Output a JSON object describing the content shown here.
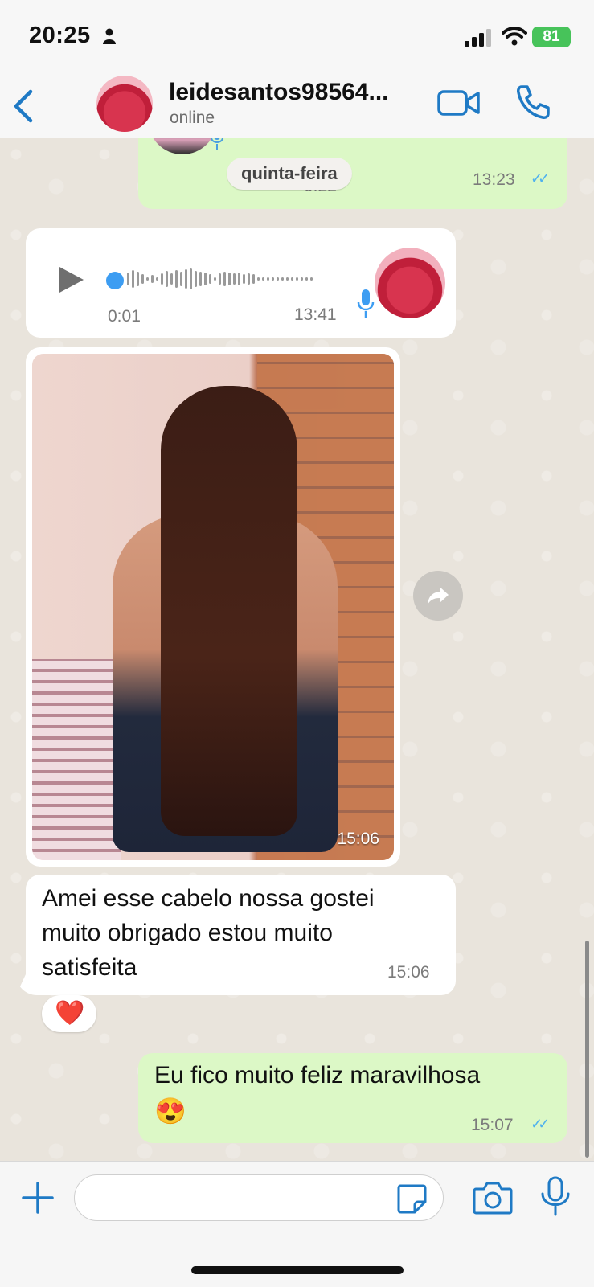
{
  "status_bar": {
    "time": "20:25",
    "battery": "81"
  },
  "header": {
    "contact_name": "leidesantos98564...",
    "contact_status": "online"
  },
  "chat": {
    "date_separator": "quinta-feira",
    "audio_out": {
      "duration": "0:22",
      "time": "13:23"
    },
    "audio_in": {
      "duration": "0:01",
      "time": "13:41"
    },
    "photo": {
      "time": "15:06"
    },
    "text_in": {
      "text": "Amei esse cabelo nossa gostei muito obrigado estou muito satisfeita",
      "time": "15:06",
      "reaction": "❤️"
    },
    "text_out": {
      "text": "Eu fico muito feliz maravilhosa",
      "emoji": "😍",
      "time": "15:07"
    }
  },
  "colors": {
    "accent": "#1f7ac5",
    "outgoing_bubble": "#dcf8c6",
    "incoming_bubble": "#ffffff",
    "read_ticks": "#4fb1ee",
    "battery": "#47c35a"
  },
  "icons": {
    "back": "chevron-left-icon",
    "video": "video-camera-icon",
    "call": "phone-icon",
    "play": "play-icon",
    "mic": "microphone-icon",
    "forward": "forward-icon",
    "plus": "plus-icon",
    "sticker": "sticker-icon",
    "camera": "camera-icon"
  },
  "composer": {
    "value": ""
  }
}
